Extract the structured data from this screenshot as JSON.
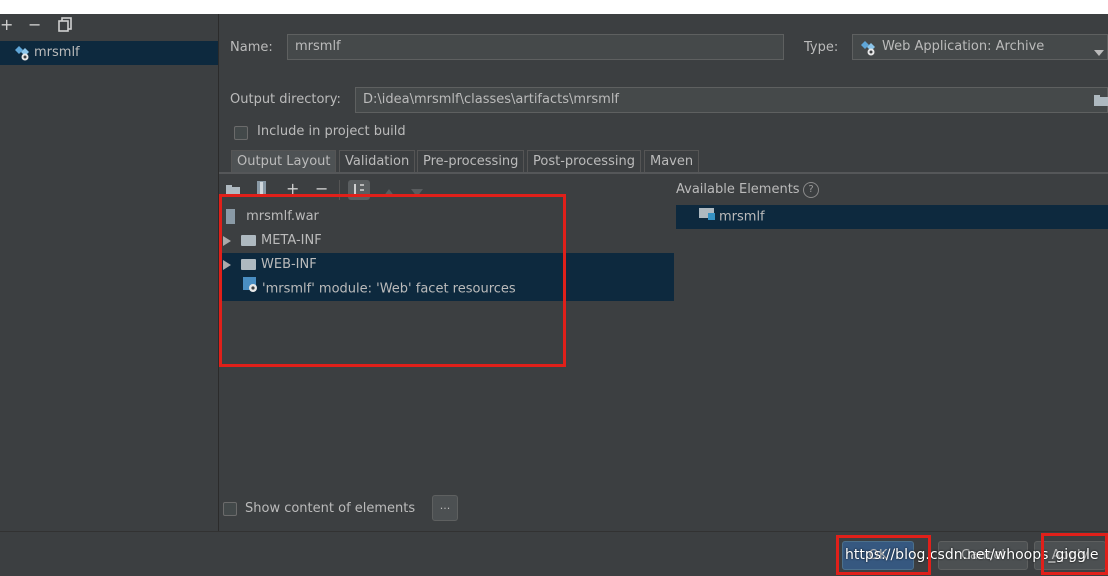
{
  "toolbar": {
    "add": "+",
    "remove": "−"
  },
  "artifacts": {
    "selected": "mrsmlf"
  },
  "form": {
    "name_label": "Name:",
    "name_value": "mrsmlf",
    "type_label": "Type:",
    "type_value": "Web Application: Archive",
    "output_dir_label": "Output directory:",
    "output_dir_value": "D:\\idea\\mrsmlf\\classes\\artifacts\\mrsmlf",
    "include_label": "Include in project build",
    "include_checked": false
  },
  "tabs": [
    {
      "label": "Output Layout",
      "active": true
    },
    {
      "label": "Validation",
      "active": false
    },
    {
      "label": "Pre-processing",
      "active": false
    },
    {
      "label": "Post-processing",
      "active": false
    },
    {
      "label": "Maven",
      "active": false
    }
  ],
  "layout_toolbar": {
    "add": "+",
    "remove": "−"
  },
  "output_tree": [
    {
      "label": "mrsmlf.war",
      "icon": "archive-icon",
      "selected": false
    },
    {
      "label": "META-INF",
      "icon": "folder-icon",
      "selected": false
    },
    {
      "label": "WEB-INF",
      "icon": "folder-icon",
      "selected": true
    },
    {
      "label": "'mrsmlf' module: 'Web' facet resources",
      "icon": "web-facet-icon",
      "selected": true
    }
  ],
  "available": {
    "title": "Available Elements",
    "help": "?",
    "items": [
      {
        "label": "mrsmlf",
        "icon": "module-folder-icon",
        "selected": true
      }
    ]
  },
  "show_content": {
    "label": "Show content of elements",
    "checked": false,
    "button": "..."
  },
  "buttons": {
    "ok": "OK",
    "cancel": "Cancel",
    "apply": "Apply"
  },
  "watermark": "https://blog.csdn.net/whoops_giggle",
  "colors": {
    "background": "#3c3f41",
    "selection": "#0d293e",
    "highlight_box": "#e0201a",
    "ok_button": "#365880"
  }
}
